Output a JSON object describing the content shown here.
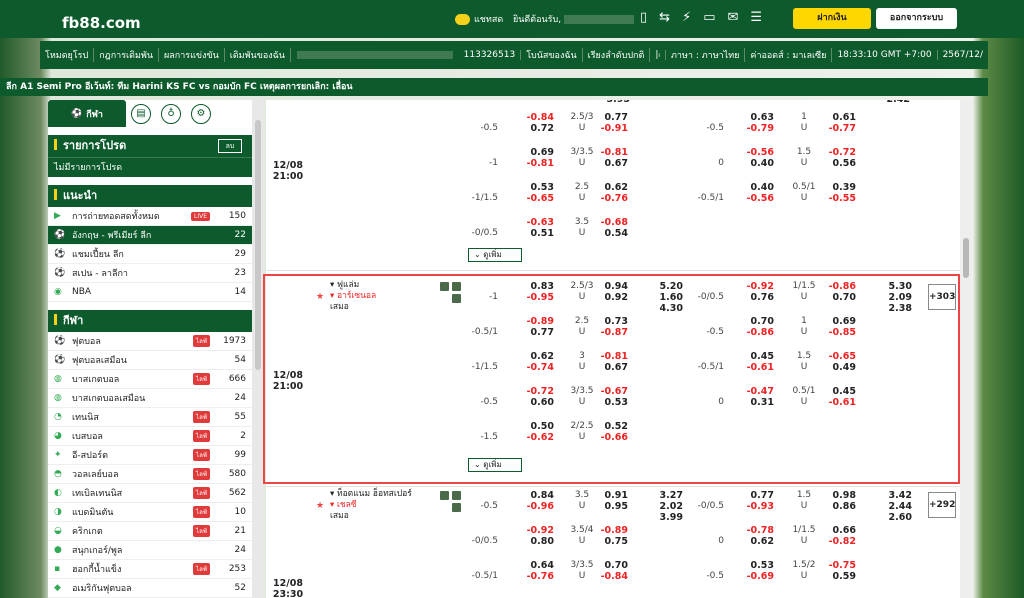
{
  "header": {
    "logo_main": "fb88",
    "logo_suffix": ".com",
    "chat_label": "แชทสด",
    "welcome": "ยินดีต้อนรับ,",
    "deposit_label": "ฝากเงิน",
    "logout_label": "ออกจากระบบ"
  },
  "nav": {
    "items": [
      "โหมดยุโรป",
      "กฎการเดิมพัน",
      "ผลการแข่งขัน",
      "เดิมพันของฉัน"
    ],
    "account_id": "113326513",
    "bonus": "โบนัสของฉัน",
    "odds_format": "เรียงลำดับปกติ",
    "lang": "ภาษา : ภาษาไทย",
    "odds_type": "ค่าออดส์ : มาเลเซีย",
    "time": "18:33:10 GMT +7:00",
    "date": "2567/12/"
  },
  "ticker": "ลีก A1 Semi Pro อีเว้นท์: ทีม Harini KS FC vs กอมบัก FC เหตุผลการยกเลิก: เลื่อน",
  "sidebar": {
    "main_tab": "กีฬา",
    "fav_title": "รายการโปรด",
    "fav_delete": "ลบ",
    "fav_empty": "ไม่มีรายการโปรด",
    "rec_title": "แนะนำ",
    "rec_items": [
      {
        "name": "การถ่ายทอดสดทั้งหมด",
        "count": "150",
        "live": "LIVE"
      },
      {
        "name": "อังกฤษ - พรีเมียร์ ลีก",
        "count": "22",
        "live": ""
      },
      {
        "name": "แชมเปี้ยน ลีก",
        "count": "29",
        "live": ""
      },
      {
        "name": "สเปน - ลาลีกา",
        "count": "23",
        "live": ""
      },
      {
        "name": "NBA",
        "count": "14",
        "live": ""
      }
    ],
    "sports_title": "กีฬา",
    "sports": [
      {
        "name": "ฟุตบอล",
        "count": "1973",
        "live": "ไลฟ์"
      },
      {
        "name": "ฟุตบอลเสมือน",
        "count": "54",
        "live": ""
      },
      {
        "name": "บาสเกตบอล",
        "count": "666",
        "live": "ไลฟ์"
      },
      {
        "name": "บาสเกตบอลเสมือน",
        "count": "24",
        "live": ""
      },
      {
        "name": "เทนนิส",
        "count": "55",
        "live": "ไลฟ์"
      },
      {
        "name": "เบสบอล",
        "count": "2",
        "live": "ไลฟ์"
      },
      {
        "name": "อี-สปอร์ต",
        "count": "99",
        "live": "ไลฟ์"
      },
      {
        "name": "วอลเลย์บอล",
        "count": "580",
        "live": "ไลฟ์"
      },
      {
        "name": "เทเบิลเทนนิส",
        "count": "562",
        "live": "ไลฟ์"
      },
      {
        "name": "แบดมินตัน",
        "count": "10",
        "live": "ไลฟ์"
      },
      {
        "name": "คริกเกต",
        "count": "21",
        "live": "ไลฟ์"
      },
      {
        "name": "สนุกเกอร์/พูล",
        "count": "24",
        "live": ""
      },
      {
        "name": "ฮอกกี้น้ำแข็ง",
        "count": "253",
        "live": "ไลฟ์"
      },
      {
        "name": "อเมริกันฟุตบอล",
        "count": "52",
        "live": ""
      }
    ]
  },
  "more_label": "ดูเพิ่ม",
  "match0": {
    "date": "12/08",
    "time": "21:00",
    "top_partial": "3.95",
    "top_right_partial": "2.42",
    "rows": [
      [
        "",
        "-0.84",
        "2.5/3",
        "0.77",
        "",
        "",
        "0.63",
        "1",
        "0.61"
      ],
      [
        "-0.5",
        "0.72",
        "U",
        "-0.91",
        "",
        "-0.5",
        "-0.79",
        "U",
        "-0.77"
      ],
      [
        "",
        "0.69",
        "3/3.5",
        "-0.81",
        "",
        "",
        "-0.56",
        "1.5",
        "-0.72"
      ],
      [
        "-1",
        "-0.81",
        "U",
        "0.67",
        "",
        "0",
        "0.40",
        "U",
        "0.56"
      ],
      [
        "",
        "0.53",
        "2.5",
        "0.62",
        "",
        "",
        "0.40",
        "0.5/1",
        "0.39"
      ],
      [
        "-1/1.5",
        "-0.65",
        "U",
        "-0.76",
        "",
        "-0.5/1",
        "-0.56",
        "U",
        "-0.55"
      ],
      [
        "",
        "-0.63",
        "3.5",
        "-0.68",
        "",
        "",
        "",
        "",
        ""
      ],
      [
        "-0/0.5",
        "0.51",
        "U",
        "0.54",
        "",
        "",
        "",
        "",
        ""
      ]
    ]
  },
  "match1": {
    "date": "12/08",
    "time": "21:00",
    "home": "ฟูแล่ม",
    "away": "อาร์เซนอล",
    "draw": "เสมอ",
    "more_count": "+303",
    "x12": [
      "5.20",
      "1.60",
      "4.30"
    ],
    "x12h": [
      "5.30",
      "2.09",
      "2.38"
    ],
    "rows": [
      [
        "",
        "0.83",
        "2.5/3",
        "0.94",
        "",
        "",
        "-0.92",
        "1/1.5",
        "-0.86"
      ],
      [
        "-1",
        "-0.95",
        "U",
        "0.92",
        "",
        "-0/0.5",
        "0.76",
        "U",
        "0.70"
      ],
      [
        "",
        "-0.89",
        "2.5",
        "0.73",
        "",
        "",
        "0.70",
        "1",
        "0.69"
      ],
      [
        "-0.5/1",
        "0.77",
        "U",
        "-0.87",
        "",
        "-0.5",
        "-0.86",
        "U",
        "-0.85"
      ],
      [
        "",
        "0.62",
        "3",
        "-0.81",
        "",
        "",
        "0.45",
        "1.5",
        "-0.65"
      ],
      [
        "-1/1.5",
        "-0.74",
        "U",
        "0.67",
        "",
        "-0.5/1",
        "-0.61",
        "U",
        "0.49"
      ],
      [
        "",
        "-0.72",
        "3/3.5",
        "-0.67",
        "",
        "",
        "-0.47",
        "0.5/1",
        "0.45"
      ],
      [
        "-0.5",
        "0.60",
        "U",
        "0.53",
        "",
        "0",
        "0.31",
        "U",
        "-0.61"
      ],
      [
        "",
        "0.50",
        "2/2.5",
        "0.52",
        "",
        "",
        "",
        "",
        ""
      ],
      [
        "-1.5",
        "-0.62",
        "U",
        "-0.66",
        "",
        "",
        "",
        "",
        ""
      ]
    ]
  },
  "match2": {
    "date": "12/08",
    "time": "23:30",
    "home": "ท็อตแนม ฮ็อทสเปอร์",
    "away": "เชลซี",
    "draw": "เสมอ",
    "more_count": "+292",
    "x12": [
      "3.27",
      "2.02",
      "3.99"
    ],
    "x12h": [
      "3.42",
      "2.44",
      "2.60"
    ],
    "rows": [
      [
        "",
        "0.84",
        "3.5",
        "0.91",
        "",
        "",
        "0.77",
        "1.5",
        "0.98"
      ],
      [
        "-0.5",
        "-0.96",
        "U",
        "0.95",
        "",
        "-0/0.5",
        "-0.93",
        "U",
        "0.86"
      ],
      [
        "",
        "-0.92",
        "3.5/4",
        "-0.89",
        "",
        "",
        "-0.78",
        "1/1.5",
        "0.66"
      ],
      [
        "-0/0.5",
        "0.80",
        "U",
        "0.75",
        "",
        "0",
        "0.62",
        "U",
        "-0.82"
      ],
      [
        "",
        "0.64",
        "3/3.5",
        "0.70",
        "",
        "",
        "0.53",
        "1.5/2",
        "-0.75"
      ],
      [
        "-0.5/1",
        "-0.76",
        "U",
        "-0.84",
        "",
        "-0.5",
        "-0.69",
        "U",
        "0.59"
      ]
    ]
  }
}
